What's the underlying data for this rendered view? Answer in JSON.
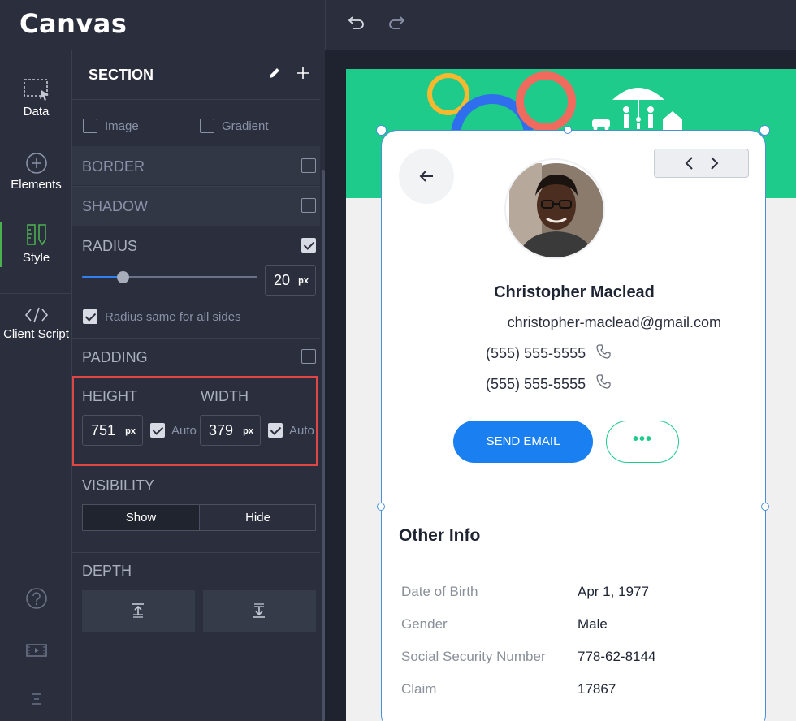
{
  "app": {
    "logo": "Canvas"
  },
  "rail": {
    "items": [
      {
        "label": "Data",
        "icon": "data-select-icon"
      },
      {
        "label": "Elements",
        "icon": "plus-circle-icon"
      },
      {
        "label": "Style",
        "icon": "style-tools-icon",
        "active": true
      },
      {
        "label": "Client Script",
        "icon": "code-icon"
      }
    ],
    "bottom_icons": [
      "help-icon",
      "video-icon",
      "menu-icon"
    ]
  },
  "panel": {
    "title": "SECTION",
    "background": {
      "image_label": "Image",
      "image_checked": false,
      "gradient_label": "Gradient",
      "gradient_checked": false
    },
    "border": {
      "label": "BORDER",
      "checked": false
    },
    "shadow": {
      "label": "SHADOW",
      "checked": false
    },
    "radius": {
      "label": "RADIUS",
      "checked": true,
      "value": "20",
      "unit": "px",
      "slider_fraction": 0.23,
      "same_label": "Radius same for all sides",
      "same_checked": true
    },
    "padding": {
      "label": "PADDING",
      "checked": false
    },
    "height": {
      "label": "HEIGHT",
      "value": "751",
      "unit": "px",
      "auto_label": "Auto",
      "auto_checked": true
    },
    "width": {
      "label": "WIDTH",
      "value": "379",
      "unit": "px",
      "auto_label": "Auto",
      "auto_checked": true
    },
    "visibility": {
      "label": "VISIBILITY",
      "options": [
        "Show",
        "Hide"
      ],
      "selected": "Show"
    },
    "depth": {
      "label": "DEPTH"
    }
  },
  "profile": {
    "name": "Christopher Maclead",
    "email": "christopher-maclead@gmail.com",
    "phones": [
      "(555) 555-5555",
      "(555) 555-5555"
    ],
    "send_email_label": "SEND EMAIL",
    "more_label": "•••"
  },
  "other_info": {
    "title": "Other Info",
    "rows": [
      {
        "key": "Date of Birth",
        "value": "Apr 1, 1977"
      },
      {
        "key": "Gender",
        "value": "Male"
      },
      {
        "key": "Social Security Number",
        "value": "778-62-8144"
      },
      {
        "key": "Claim",
        "value": "17867"
      }
    ]
  },
  "colors": {
    "accent_green": "#1ecb8b",
    "primary_blue": "#1a7ff0",
    "selection_blue": "#4a90d9",
    "highlight_red": "#e04646",
    "rail_active": "#4caf50"
  }
}
